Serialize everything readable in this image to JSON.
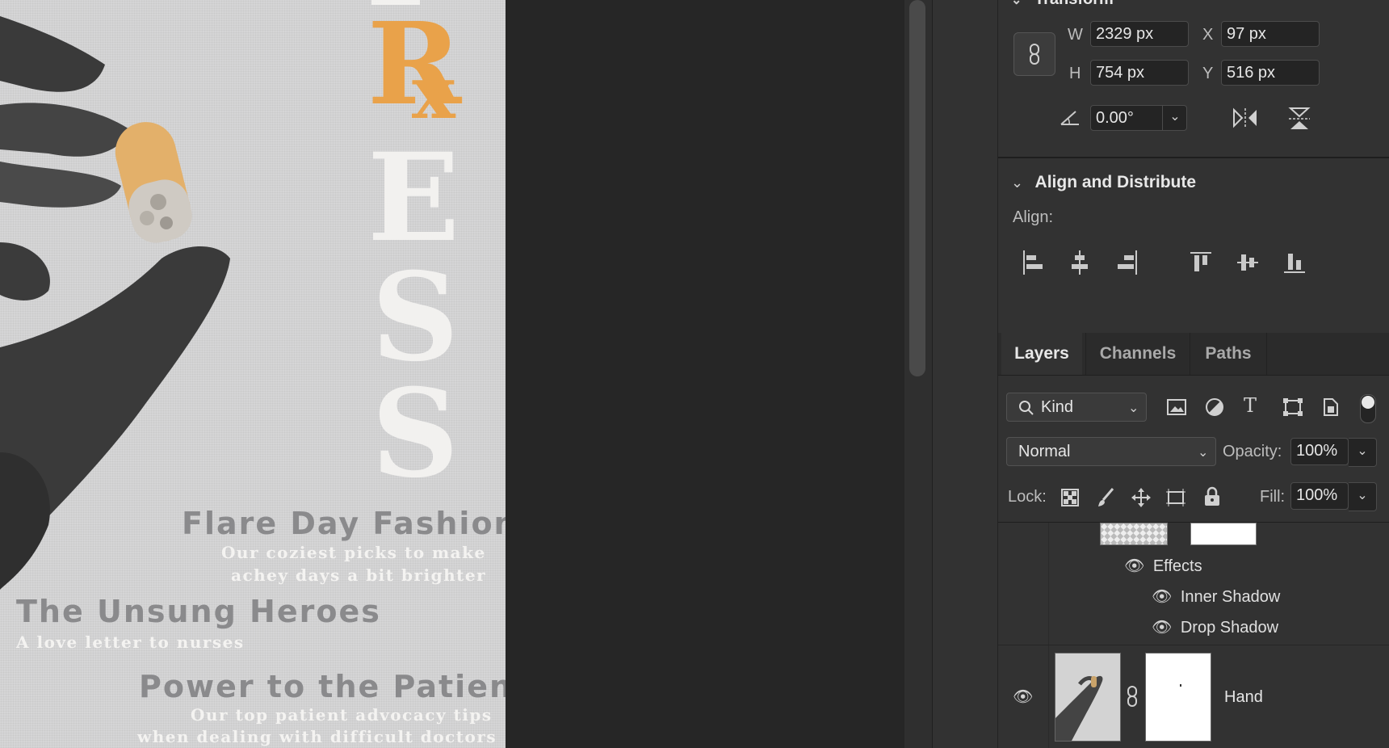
{
  "poster": {
    "letters": {
      "rx_r": "R",
      "rx_x": "x",
      "e": "E",
      "s1": "S",
      "s2": "S"
    },
    "stories": [
      {
        "title": "Flare Day Fashion",
        "sub1": "Our coziest picks to make",
        "sub2": "achey days a bit brighter"
      },
      {
        "title": "The Unsung Heroes",
        "sub1": "A love letter to nurses"
      },
      {
        "title": "Power to the Patient",
        "sub1": "Our top patient advocacy tips",
        "sub2": "when dealing with difficult doctors"
      }
    ]
  },
  "transform": {
    "title": "Transform",
    "w_label": "W",
    "w_value": "2329 px",
    "h_label": "H",
    "h_value": "754 px",
    "x_label": "X",
    "x_value": "97 px",
    "y_label": "Y",
    "y_value": "516 px",
    "angle_value": "0.00°"
  },
  "align": {
    "title": "Align and Distribute",
    "align_label": "Align:"
  },
  "layers": {
    "tabs": [
      "Layers",
      "Channels",
      "Paths"
    ],
    "filter_kind": "Kind",
    "blend_mode": "Normal",
    "opacity_label": "Opacity:",
    "opacity_value": "100%",
    "lock_label": "Lock:",
    "fill_label": "Fill:",
    "fill_value": "100%",
    "effects_label": "Effects",
    "effect_items": [
      "Inner Shadow",
      "Drop Shadow"
    ],
    "hand_layer_name": "Hand"
  },
  "colors": {
    "accent_orange": "#e9a24a",
    "panel_bg": "#323232"
  }
}
